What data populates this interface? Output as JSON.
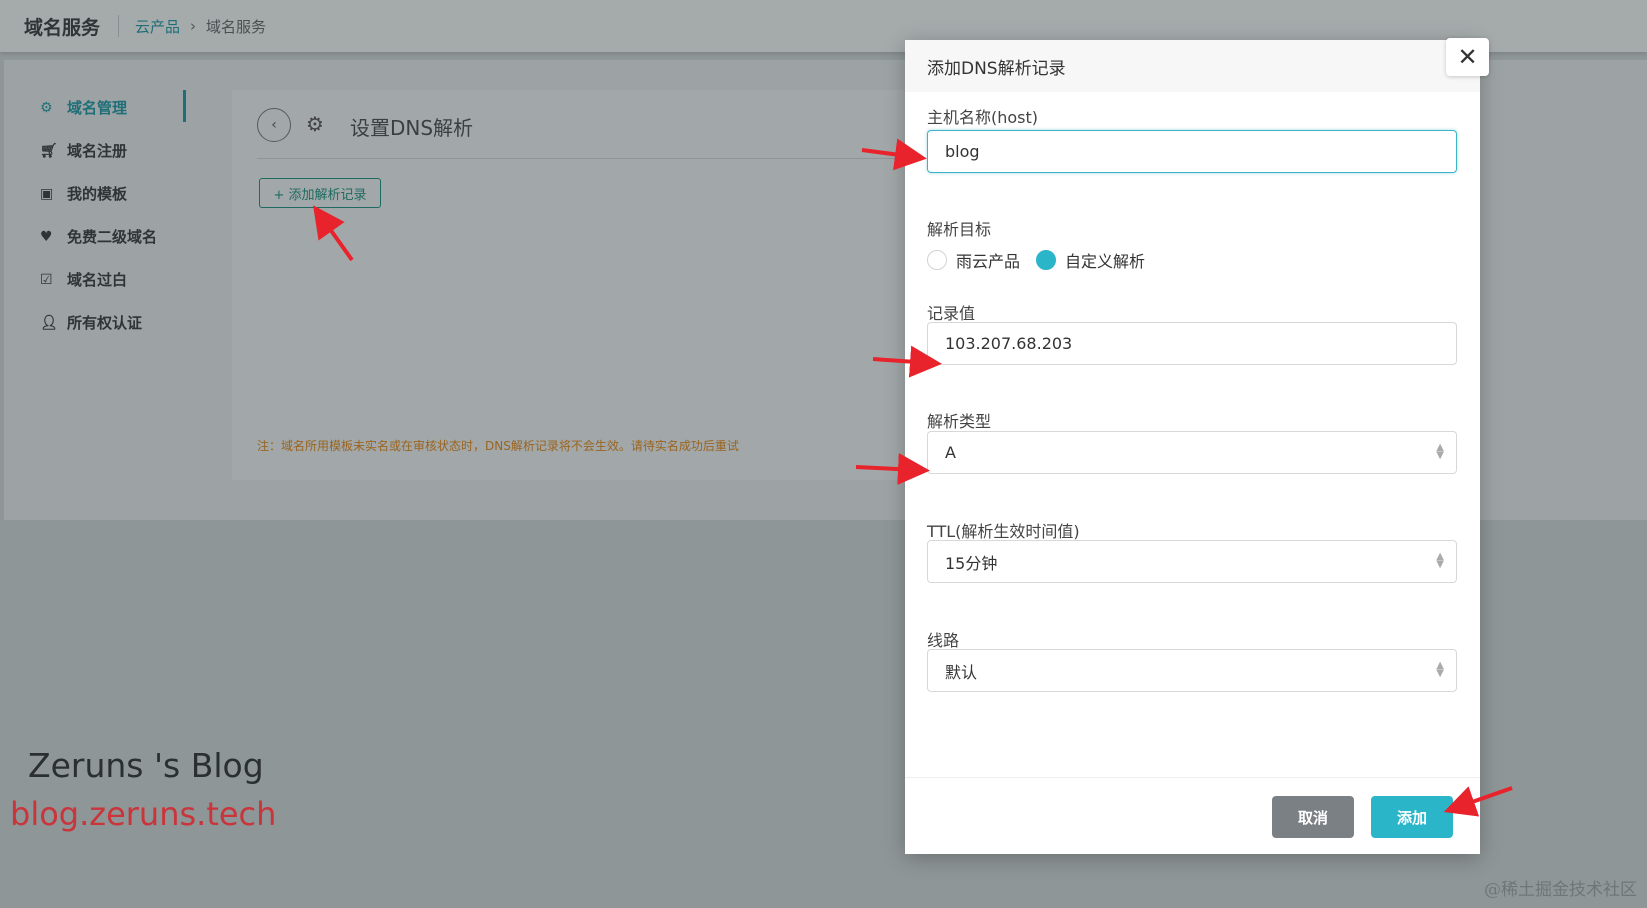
{
  "header": {
    "app_title": "域名服务",
    "breadcrumb": [
      "云产品",
      "域名服务"
    ]
  },
  "sidebar": {
    "items": [
      {
        "label": "域名管理",
        "icon": "gears-icon",
        "active": true
      },
      {
        "label": "域名注册",
        "icon": "cart-icon",
        "active": false
      },
      {
        "label": "我的模板",
        "icon": "id-card-icon",
        "active": false
      },
      {
        "label": "免费二级域名",
        "icon": "heart-icon",
        "active": false
      },
      {
        "label": "域名过白",
        "icon": "checkbox-icon",
        "active": false
      },
      {
        "label": "所有权认证",
        "icon": "user-check-icon",
        "active": false
      }
    ]
  },
  "main": {
    "title": "设置DNS解析",
    "add_record_label": "+ 添加解析记录",
    "note": "注：域名所用模板未实名或在审核状态时，DNS解析记录将不会生效。请待实名成功后重试"
  },
  "modal": {
    "title": "添加DNS解析记录",
    "host_label": "主机名称(host)",
    "host_value": "blog",
    "target_label": "解析目标",
    "target_options": [
      {
        "label": "雨云产品",
        "checked": false
      },
      {
        "label": "自定义解析",
        "checked": true
      }
    ],
    "record_label": "记录值",
    "record_value": "103.207.68.203",
    "type_label": "解析类型",
    "type_value": "A",
    "ttl_label": "TTL(解析生效时间值)",
    "ttl_value": "15分钟",
    "line_label": "线路",
    "line_value": "默认",
    "cancel_label": "取消",
    "add_label": "添加"
  },
  "watermark": {
    "blog_name": "Zeruns 's Blog",
    "blog_url": "blog.zeruns.tech",
    "corner": "@稀土掘金技术社区"
  },
  "colors": {
    "accent": "#2bb5c9",
    "annotation_arrow": "#e8232b"
  }
}
